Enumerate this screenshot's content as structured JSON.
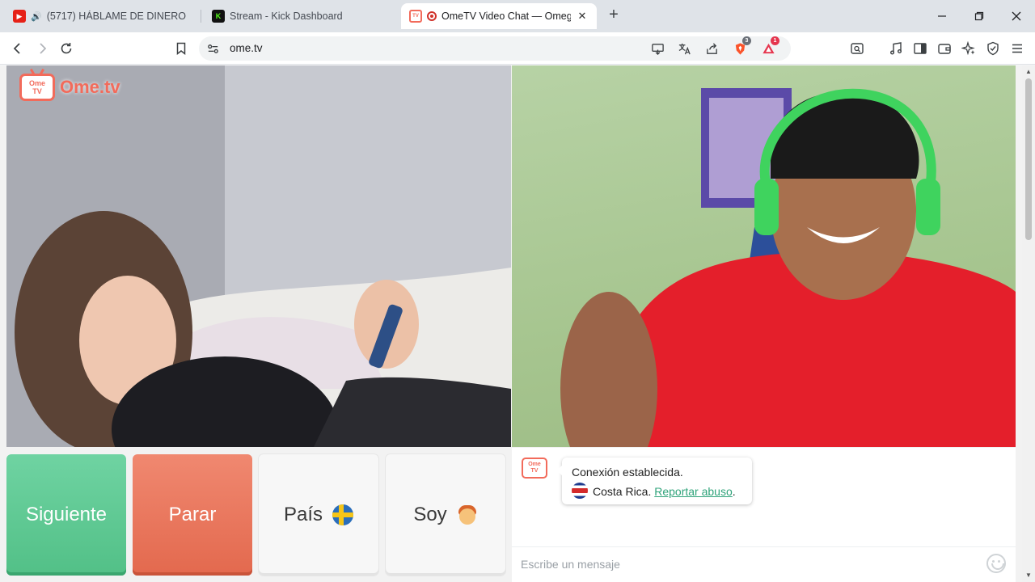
{
  "browser": {
    "tabs": [
      {
        "title": "(5717) HÁBLAME DE DINERO 💰",
        "favicon": "youtube-icon",
        "audio": "speaker-icon",
        "active": false
      },
      {
        "title": "Stream - Kick Dashboard",
        "favicon": "kick-icon",
        "active": false
      },
      {
        "title": "OmeTV Video Chat — Omegle",
        "favicon": "ometv-icon",
        "recording": true,
        "active": true
      }
    ],
    "new_tab_label": "+",
    "address": "ome.tv",
    "badges": {
      "brave_shields": "3",
      "rewards": "1"
    },
    "window_controls": [
      "minimize-icon",
      "restore-icon",
      "close-icon"
    ]
  },
  "site": {
    "logo_badge": "Ome\nTV",
    "logo_text": "Ome.tv"
  },
  "controls": {
    "next_label": "Siguiente",
    "stop_label": "Parar",
    "country_label": "País",
    "country_flag": "sweden-flag-icon",
    "gender_label": "Soy",
    "gender_icon": "boy-emoji-icon"
  },
  "chat": {
    "system_message": "Conexión establecida.",
    "country_name": "Costa Rica.",
    "report_link": "Reportar abuso",
    "input_placeholder": "Escribe un mensaje"
  },
  "colors": {
    "next": "#5cc896",
    "stop": "#e8755b",
    "brand": "#f26b5b",
    "link": "#2fa37a"
  }
}
